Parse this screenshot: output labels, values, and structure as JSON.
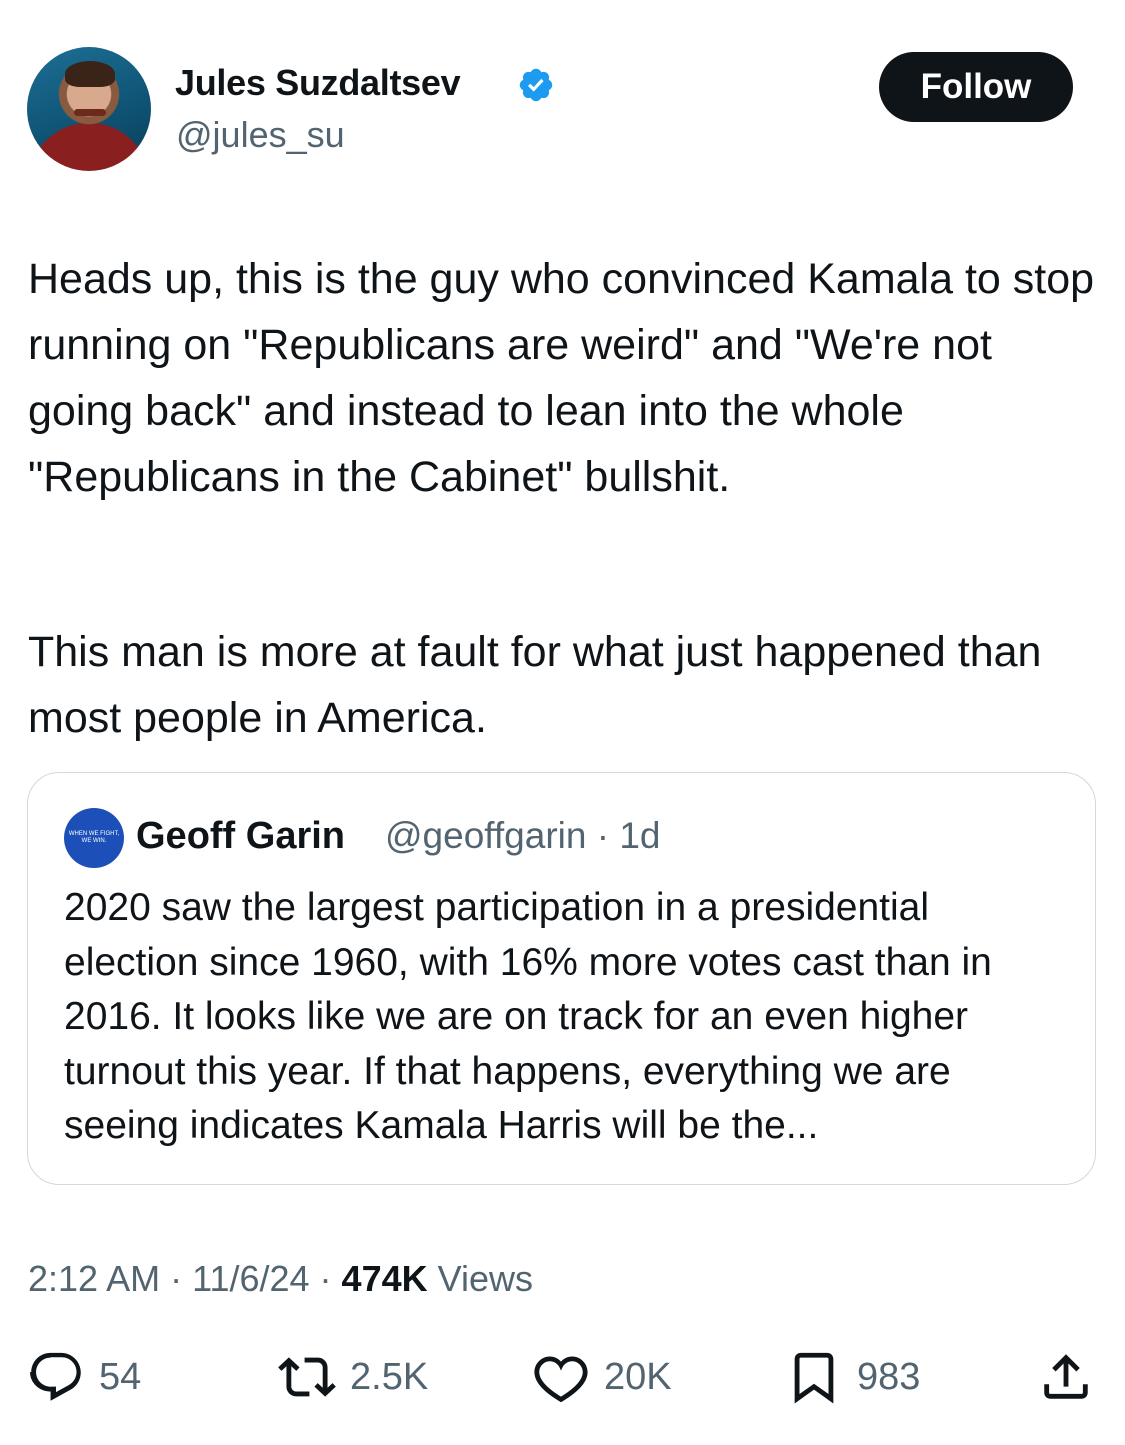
{
  "author": {
    "name": "Jules Suzdaltsev",
    "handle": "@jules_su",
    "verified": true,
    "follow_label": "Follow"
  },
  "tweet": {
    "paragraphs": [
      "Heads up, this is the guy who convinced Kamala to stop running on \"Republicans are weird\" and \"We're not going back\" and instead to lean into the whole \"Republicans in the Cabinet\" bullshit.",
      "This man is more at fault for what just happened than most people in America."
    ]
  },
  "quoted": {
    "name": "Geoff Garin",
    "handle": "@geoffgarin",
    "age": "1d",
    "avatar_text": "WHEN WE FIGHT, WE WIN.",
    "text": "2020 saw the largest participation in a presidential election since 1960, with 16% more votes cast than in 2016. It looks like we are on track for an even higher turnout this year. If that happens, everything we are seeing indicates Kamala Harris will be the..."
  },
  "meta": {
    "time": "2:12 AM",
    "date": "11/6/24",
    "views_count": "474K",
    "views_label": "Views"
  },
  "actions": {
    "replies": "54",
    "reposts": "2.5K",
    "likes": "20K",
    "bookmarks": "983"
  },
  "colors": {
    "text": "#0f1419",
    "secondary": "#536471",
    "verified": "#1d9bf0",
    "border": "#cfd9de"
  }
}
